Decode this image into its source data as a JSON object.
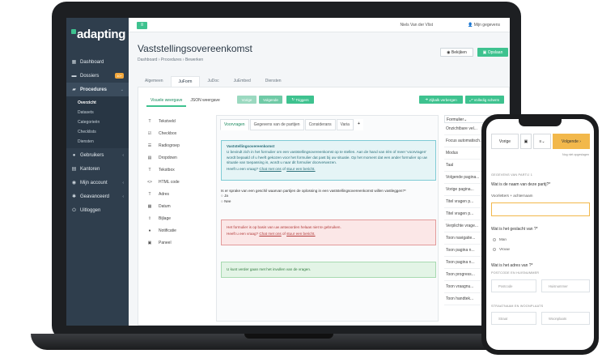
{
  "app": {
    "logo": "adapting"
  },
  "sidebar": {
    "items": [
      {
        "label": "Dashboard",
        "icon": "dashboard-icon"
      },
      {
        "label": "Dossiers",
        "icon": "cart-icon",
        "badge": "10+"
      },
      {
        "label": "Procedures",
        "icon": "folder-icon"
      }
    ],
    "subitems": [
      "Overzicht",
      "Datasets",
      "Categorieën",
      "Checklists",
      "Diensten"
    ],
    "items2": [
      {
        "label": "Gebruikers",
        "icon": "users-icon"
      },
      {
        "label": "Kantoren",
        "icon": "building-icon"
      },
      {
        "label": "Mijn account",
        "icon": "account-icon"
      },
      {
        "label": "Geavanceerd",
        "icon": "gear-icon"
      },
      {
        "label": "Uitloggen",
        "icon": "logout-icon"
      }
    ]
  },
  "topbar": {
    "user": "Niels Van der Vlist",
    "account": "Mijn gegevens"
  },
  "page": {
    "title": "Vaststellingsovereenkomst",
    "breadcrumb": [
      "Dashboard",
      "Procedures",
      "Bewerken"
    ],
    "view_label": "Bekijken",
    "save_label": "Opslaan"
  },
  "main_tabs": [
    "Algemeen",
    "JuForm",
    "JuDoc",
    "JuEmbed",
    "Diensten"
  ],
  "editor": {
    "view_tabs": [
      "Visuele weergave",
      "JSON weergave"
    ],
    "btn_prev": "Vorige",
    "btn_next": "Volgende",
    "btn_triggers": "Triggers",
    "btn_hide": "Zijbalk verbergen",
    "btn_full": "Volledig scherm"
  },
  "fields": [
    "Tekstveld",
    "Checkbox",
    "Radiogroep",
    "Dropdown",
    "Tekstbox",
    "HTML code",
    "Adres",
    "Datum",
    "Bijlage",
    "Notificatie",
    "Paneel"
  ],
  "canvas": {
    "tabs": [
      "Voorvragen",
      "Gegevens van de partijen",
      "Considerans",
      "Varia"
    ],
    "info_title": "Vaststellingsovereenkomst",
    "info_text": "U bevindt zich in het formulier om een vaststellingsovereenkomst op te stellen. Aan de hand van één of meer 'voorvragen' wordt bepaald of u heeft gekozen voor het formulier dat past bij uw situatie. Op het moment dat een ander formulier op uw situatie van toepassing is, wordt u naar dit formulier doorverwezen.",
    "help_prefix": "Heeft u een vraag?",
    "help_chat": "Chat met ons",
    "help_or": "of",
    "help_mail": "stuur een bericht.",
    "question": "Is er sprake van een geschil waarvan partijen de oplossing in een vaststellingsovereenkomst willen vastleggen?*",
    "opt_yes": "Ja",
    "opt_no": "Nee",
    "error_text": "Het formulier is op basis van uw antwoorden helaas niet te gebruiken.",
    "ok_text": "U kunt verder gaan met het invullen van de vragen."
  },
  "props": {
    "header": "Formulier",
    "items": [
      "Onzichtbare vel...",
      "Focus automatisch...",
      "Modus",
      "Taal",
      "Volgende pagina...",
      "Vorige pagina...",
      "Titel vragen p...",
      "Titel vragen p...",
      "Verplichte vrage...",
      "Toon navigatie...",
      "Toon pagina n...",
      "Toon pagina n...",
      "Toon progress...",
      "Toon vraagnu...",
      "Toon handtek..."
    ]
  },
  "phone": {
    "prev": "Vorige",
    "next": "Volgende",
    "saved": "Nog niet opgeslagen",
    "section1": "GEGEVENS VAN PARTIJ 1",
    "q_name": "Wat is de naam van deze partij?*",
    "name_hint": "Voorletters + achternaam",
    "q_gender": "Wat is het geslacht van ?*",
    "opt_man": "Man",
    "opt_vrouw": "Vrouw",
    "q_address": "Wat is het adres van ?*",
    "section2": "POSTCODE EN HUISNUMMER",
    "postcode": "Postcode",
    "huisnummer": "Huisnummer",
    "section3": "STRAATNAAM EN WOONPLAATS",
    "straat": "Straat",
    "woonplaats": "Woonplaats"
  },
  "colors": {
    "accent": "#3ec28f",
    "sidebar": "#2f3e4d",
    "info": "#7fcbd5",
    "error": "#e29a9a",
    "warning": "#f2b84b"
  }
}
